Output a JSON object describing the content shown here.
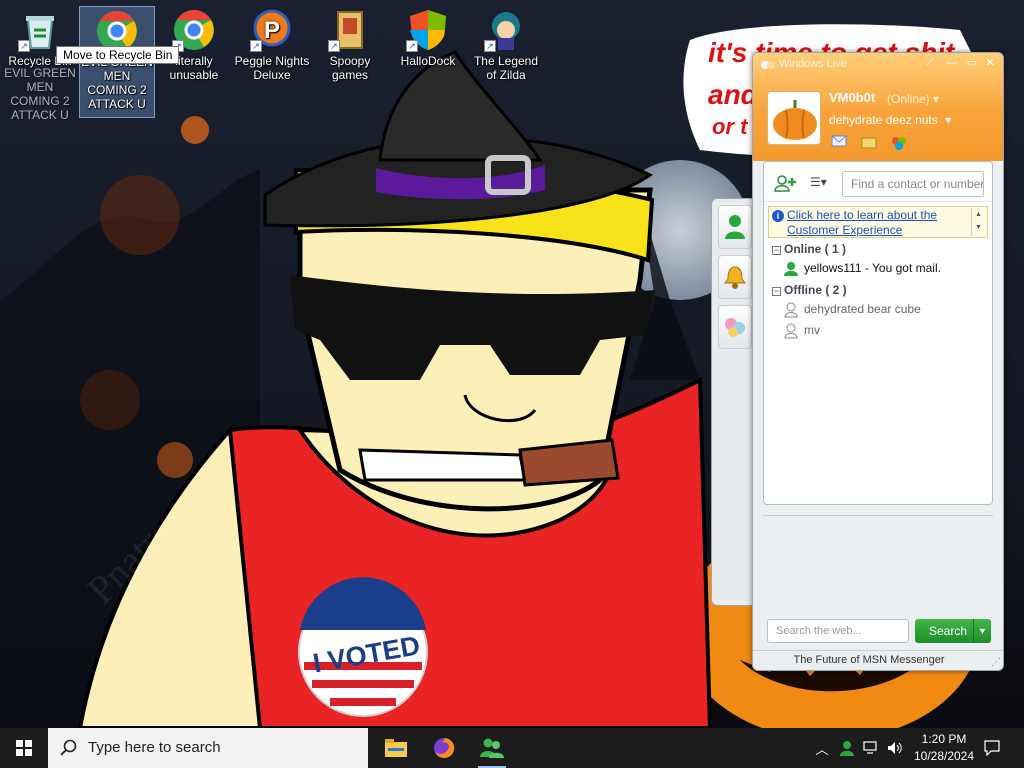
{
  "desktop": {
    "icons": [
      {
        "label": "Recycle Bin"
      },
      {
        "label": "EVIL GREEN MEN COMING 2 ATTACK U"
      },
      {
        "label": "literally unusable"
      },
      {
        "label": "Peggle Nights Deluxe"
      },
      {
        "label": "Spoopy games"
      },
      {
        "label": "HalloDock"
      },
      {
        "label": "The Legend of Zilda"
      }
    ],
    "drag_ghost_label": "EVIL GREEN MEN COMING 2 ATTACK U",
    "tooltip": "Move to Recycle Bin"
  },
  "wallpaper": {
    "banner_line1": "it's time to get shit",
    "banner_line2": "and",
    "banner_line3": "or t",
    "sticker_text": "I VOTED",
    "watermark": "Pnatrs"
  },
  "messenger": {
    "title": "Windows Live",
    "display_name": "VM0b0t",
    "status": "(Online)",
    "personal_message": "dehydrate deez nuts",
    "find_placeholder": "Find a contact or number...",
    "info_link": "Click here to learn about the Customer Experience",
    "groups": [
      {
        "name": "Online ( 1 )",
        "contacts": [
          {
            "name": "yellows111 - You got mail."
          }
        ]
      },
      {
        "name": "Offline ( 2 )",
        "contacts": [
          {
            "name": "dehydrated bear cube"
          },
          {
            "name": "mv"
          }
        ]
      }
    ],
    "search_placeholder": "Search the web...",
    "search_button": "Search",
    "footer": "The Future of MSN Messenger",
    "colors": {
      "header": "#f8a33b",
      "search": "#2a9a34",
      "link": "#1a4fd0"
    }
  },
  "taskbar": {
    "search_placeholder": "Type here to search",
    "time": "1:20 PM",
    "date": "10/28/2024"
  }
}
